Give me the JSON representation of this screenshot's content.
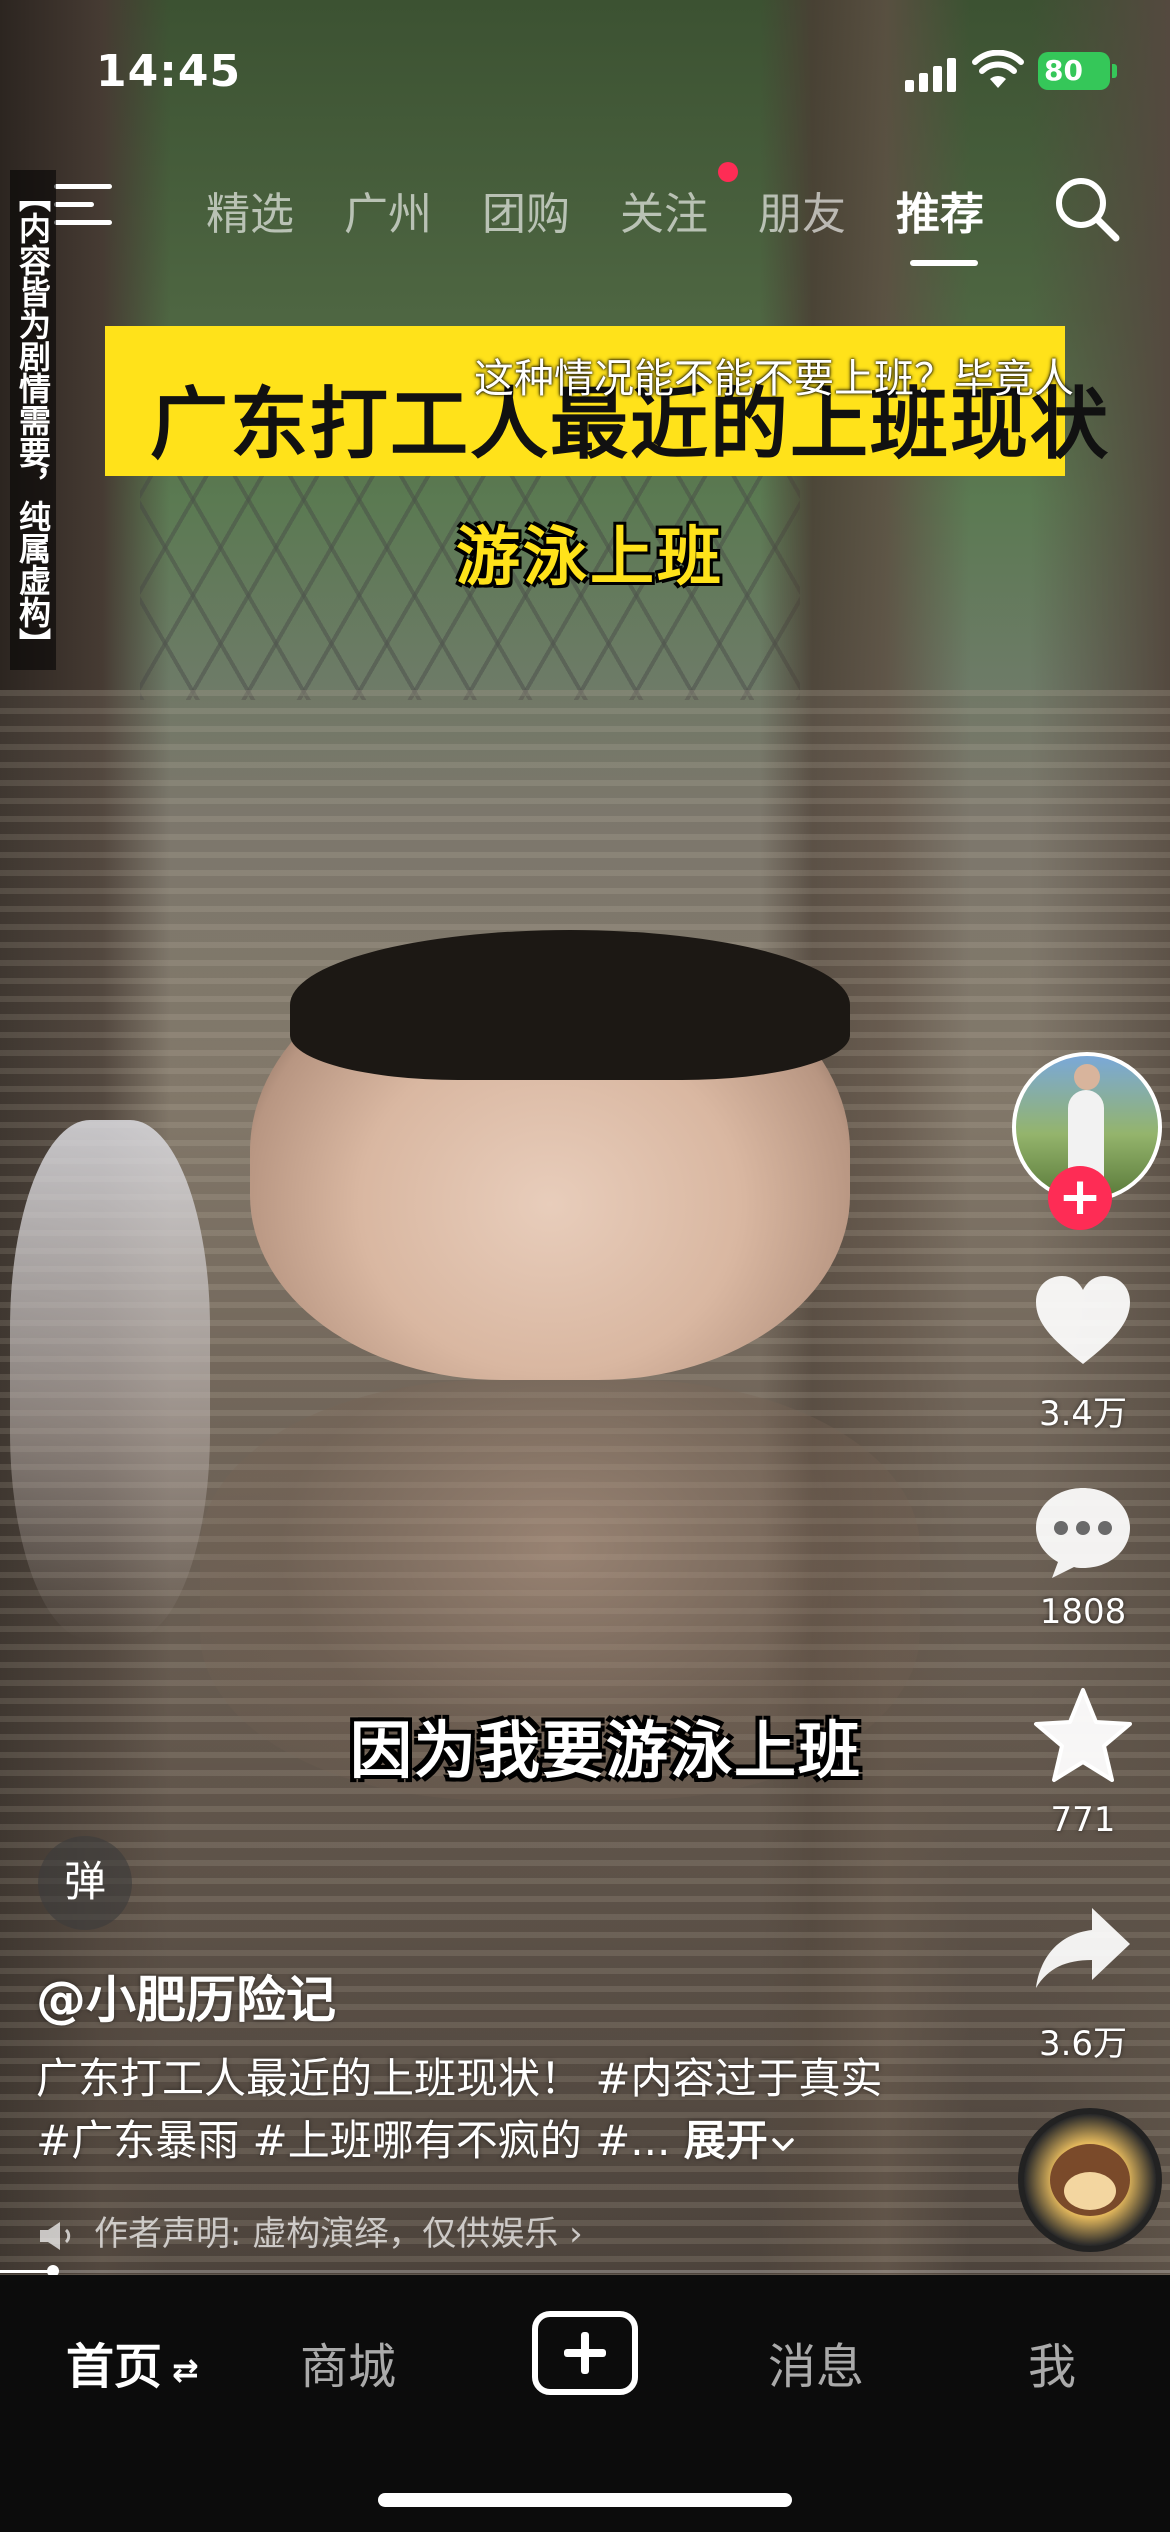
{
  "status_bar": {
    "time": "14:45",
    "battery": "80"
  },
  "top_nav": {
    "tabs": [
      {
        "label": "精选",
        "active": false
      },
      {
        "label": "广州",
        "active": false
      },
      {
        "label": "团购",
        "active": false
      },
      {
        "label": "关注",
        "active": false,
        "has_dot": true
      },
      {
        "label": "朋友",
        "active": false
      },
      {
        "label": "推荐",
        "active": true
      }
    ]
  },
  "video": {
    "side_disclaimer": "【内容皆为剧情需要，纯属虚构】",
    "title_banner": "广东打工人最近的上班现状",
    "danmaku": "这种情况能不能不要上班？毕竟人",
    "subtitle_top": "游泳上班",
    "subtitle_bottom": "因为我要游泳上班"
  },
  "actions": {
    "likes": "3.4万",
    "comments": "1808",
    "favorites": "771",
    "shares": "3.6万"
  },
  "post": {
    "danmu_toggle": "弹",
    "author": "@小肥历险记",
    "caption": "广东打工人最近的上班现状！ #内容过于真实 #广东暴雨 #上班哪有不疯的 #...",
    "expand": "展开",
    "declaration": "作者声明: 虚构演绎，仅供娱乐 ›"
  },
  "progress": {
    "played_fraction": 0.045
  },
  "tab_bar": {
    "home": "首页",
    "mall": "商城",
    "messages": "消息",
    "me": "我"
  },
  "colors": {
    "accent_red": "#fe2c55",
    "banner_yellow": "#ffe21a",
    "battery_green": "#35c759"
  }
}
